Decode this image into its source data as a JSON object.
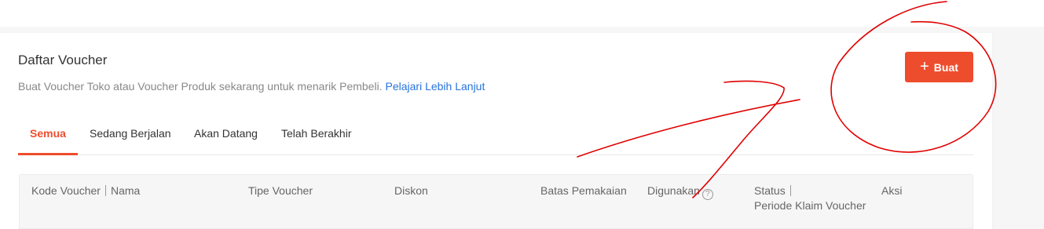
{
  "page": {
    "title": "Daftar Voucher",
    "subtitle": "Buat Voucher Toko atau Voucher Produk sekarang untuk menarik Pembeli.",
    "learn_more": "Pelajari Lebih Lanjut",
    "create_button": {
      "label": "Buat",
      "icon": "plus-icon",
      "color": "#ee4d2d"
    }
  },
  "tabs": [
    {
      "label": "Semua",
      "active": true
    },
    {
      "label": "Sedang Berjalan",
      "active": false
    },
    {
      "label": "Akan Datang",
      "active": false
    },
    {
      "label": "Telah Berakhir",
      "active": false
    }
  ],
  "table": {
    "columns": {
      "code": "Kode Voucher",
      "name": "Nama",
      "type": "Tipe Voucher",
      "discount": "Diskon",
      "limit": "Batas Pemakaian",
      "used": "Digunakan",
      "status": "Status",
      "period": "Periode Klaim Voucher",
      "actions": "Aksi"
    }
  },
  "colors": {
    "accent": "#ee4d2d",
    "link": "#2673dd",
    "annotation": "#e00000"
  }
}
